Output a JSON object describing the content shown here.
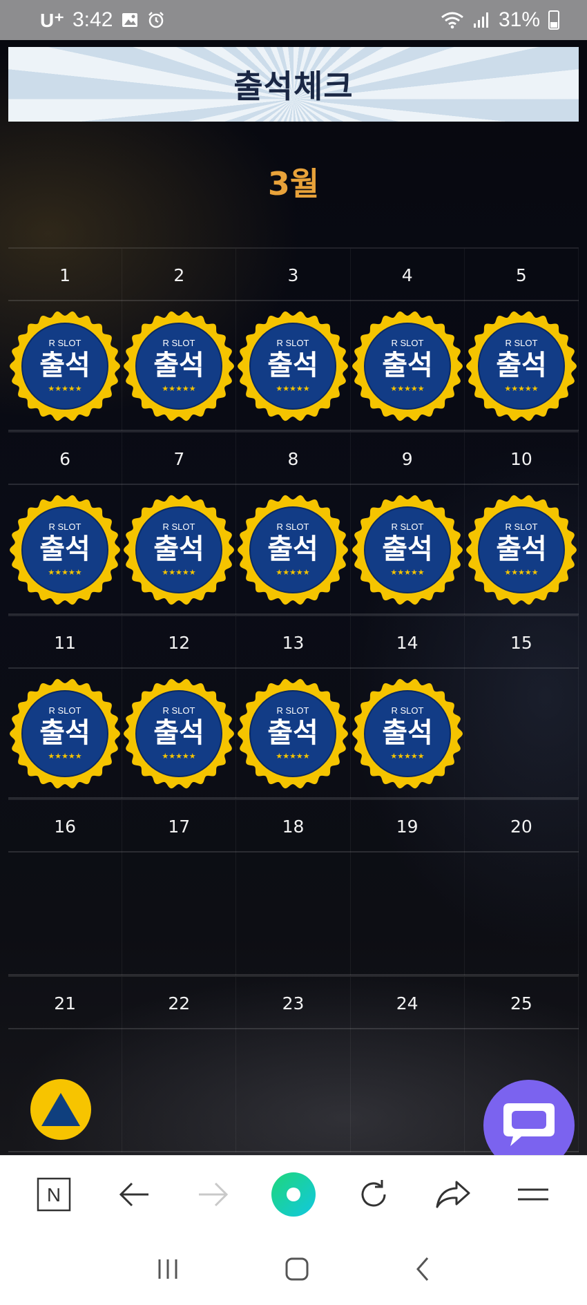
{
  "status_bar": {
    "carrier": "U⁺",
    "time": "3:42",
    "battery": "31%",
    "icons": [
      "image-icon",
      "alarm-icon",
      "wifi-icon",
      "signal-icon",
      "battery-icon"
    ]
  },
  "header": {
    "title": "출석체크",
    "month": "3월"
  },
  "calendar": {
    "rows": [
      {
        "days": [
          "1",
          "2",
          "3",
          "4",
          "5"
        ],
        "attended": [
          true,
          true,
          true,
          true,
          true
        ]
      },
      {
        "days": [
          "6",
          "7",
          "8",
          "9",
          "10"
        ],
        "attended": [
          true,
          true,
          true,
          true,
          true
        ]
      },
      {
        "days": [
          "11",
          "12",
          "13",
          "14",
          "15"
        ],
        "attended": [
          true,
          true,
          true,
          true,
          false
        ]
      },
      {
        "days": [
          "16",
          "17",
          "18",
          "19",
          "20"
        ],
        "attended": [
          false,
          false,
          false,
          false,
          false
        ]
      },
      {
        "days": [
          "21",
          "22",
          "23",
          "24",
          "25"
        ],
        "attended": [
          false,
          false,
          false,
          false,
          false
        ]
      }
    ],
    "badge": {
      "brand": "R SLOT",
      "label": "출석",
      "stars": "★★★★★"
    }
  },
  "colors": {
    "badge_ring": "#f5c400",
    "badge_face": "#123c86",
    "month": "#e8a23a",
    "chat_button": "#7b63ef",
    "top_button": "#f7c400"
  },
  "browser_toolbar": {
    "icons": [
      "naver-n-icon",
      "back-arrow-icon",
      "forward-arrow-icon",
      "home-green-circle-icon",
      "reload-icon",
      "share-icon",
      "menu-icon"
    ],
    "naver_label": "N"
  },
  "nav_bar": {
    "icons": [
      "recents-icon",
      "home-icon",
      "back-icon"
    ]
  }
}
